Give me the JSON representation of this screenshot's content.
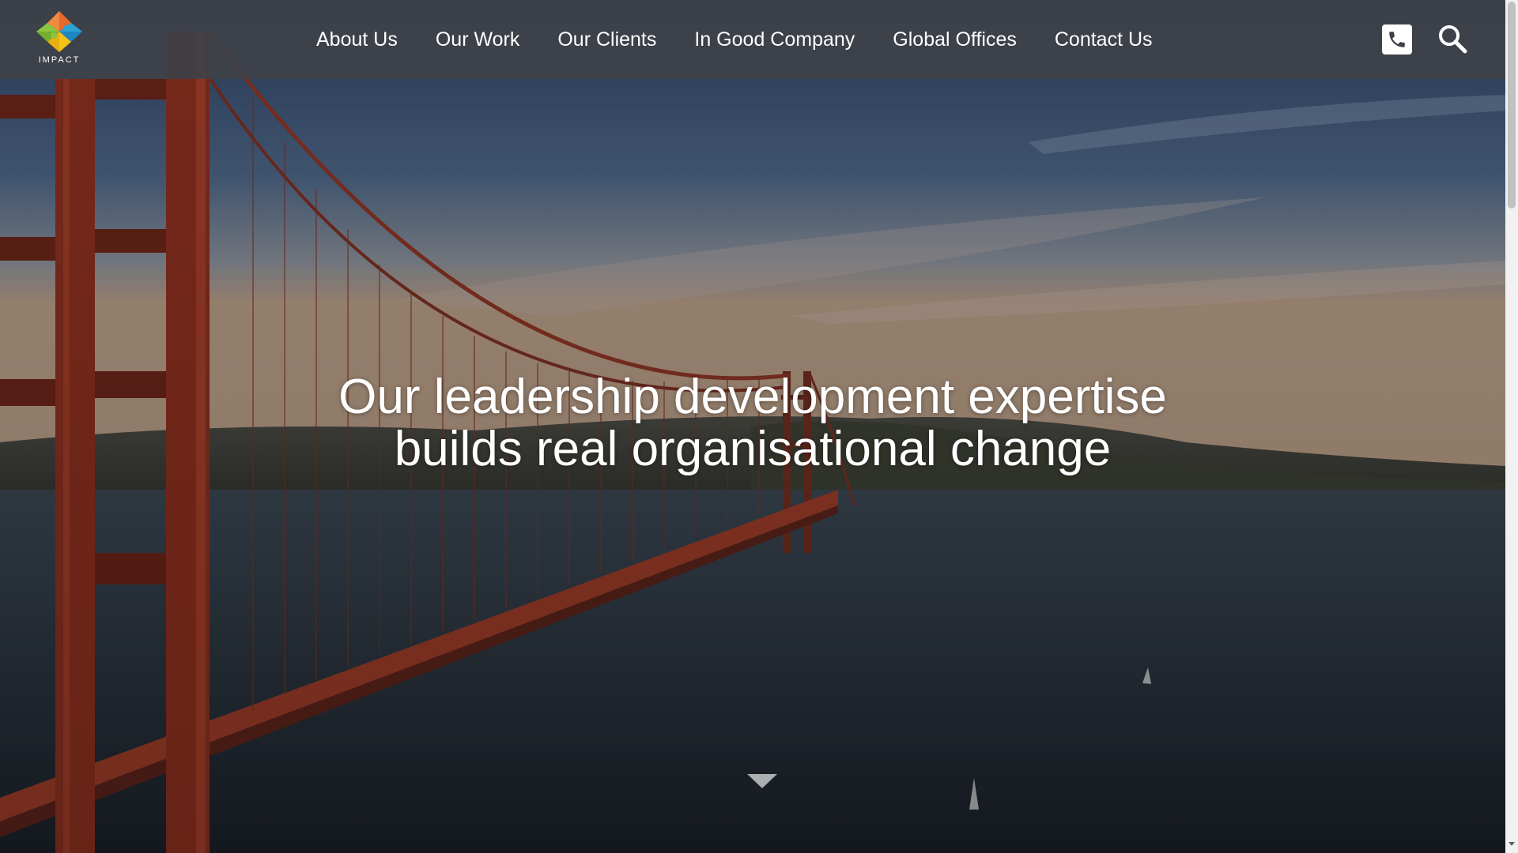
{
  "brand": {
    "name": "IMPACT",
    "logo_icon": "puzzle-diamond-logo",
    "logo_colors": [
      "#e8692d",
      "#2aa3d8",
      "#f2c21b",
      "#8cc63f"
    ]
  },
  "nav": {
    "items": [
      {
        "label": "About Us"
      },
      {
        "label": "Our Work"
      },
      {
        "label": "Our Clients"
      },
      {
        "label": "In Good Company"
      },
      {
        "label": "Global Offices"
      },
      {
        "label": "Contact Us"
      }
    ]
  },
  "header": {
    "phone_icon": "phone-icon",
    "search_icon": "search-icon",
    "background": "#3e4248"
  },
  "hero": {
    "headline_line1": "Our leadership development expertise",
    "headline_line2": "builds real organisational change",
    "scroll_icon": "chevron-down-icon"
  }
}
